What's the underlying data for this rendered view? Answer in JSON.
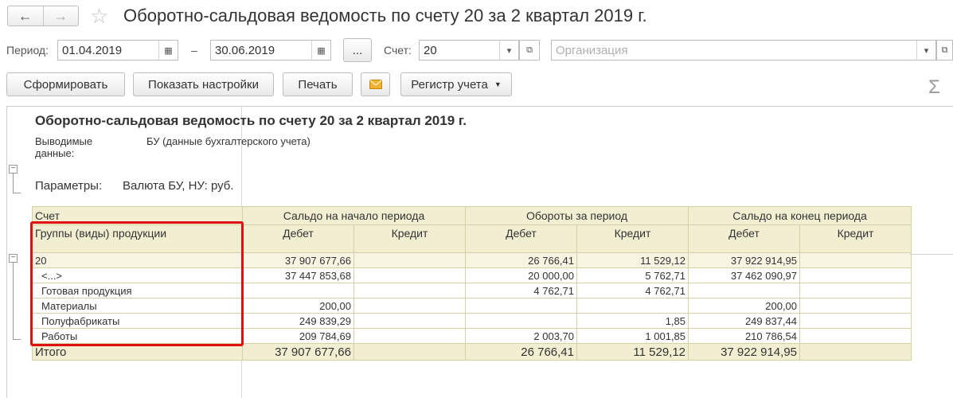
{
  "window": {
    "title": "Оборотно-сальдовая ведомость по счету 20 за 2 квартал 2019 г.",
    "back_icon": "←",
    "forward_icon": "→",
    "star_icon": "☆"
  },
  "form": {
    "period_label": "Период:",
    "date_from": "01.04.2019",
    "date_separator": "–",
    "date_to": "30.06.2019",
    "ellipsis_label": "...",
    "account_label": "Счет:",
    "account_value": "20",
    "organization_placeholder": "Организация"
  },
  "toolbar": {
    "generate_label": "Сформировать",
    "settings_label": "Показать настройки",
    "print_label": "Печать",
    "register_label": "Регистр учета",
    "sigma": "Σ"
  },
  "report": {
    "title": "Оборотно-сальдовая ведомость по счету 20 за 2 квартал 2019 г.",
    "output_label_1": "Выводимые",
    "output_label_2": "данные:",
    "output_value": "БУ (данные бухгалтерского учета)",
    "params_label": "Параметры:",
    "params_value": "Валюта БУ, НУ: руб.",
    "headers": {
      "account": "Счет",
      "groups": "Группы (виды) продукции",
      "opening": "Сальдо на начало периода",
      "turnover": "Обороты за период",
      "closing": "Сальдо на конец периода",
      "debit": "Дебет",
      "credit": "Кредит"
    },
    "rows": [
      {
        "name": "20",
        "ob_d": "37 907 677,66",
        "ob_c": "",
        "t_d": "26 766,41",
        "t_c": "11 529,12",
        "cb_d": "37 922 914,95",
        "cb_c": ""
      },
      {
        "name": "<...>",
        "ob_d": "37 447 853,68",
        "ob_c": "",
        "t_d": "20 000,00",
        "t_c": "5 762,71",
        "cb_d": "37 462 090,97",
        "cb_c": ""
      },
      {
        "name": "Готовая продукция",
        "ob_d": "",
        "ob_c": "",
        "t_d": "4 762,71",
        "t_c": "4 762,71",
        "cb_d": "",
        "cb_c": ""
      },
      {
        "name": "Материалы",
        "ob_d": "200,00",
        "ob_c": "",
        "t_d": "",
        "t_c": "",
        "cb_d": "200,00",
        "cb_c": ""
      },
      {
        "name": "Полуфабрикаты",
        "ob_d": "249 839,29",
        "ob_c": "",
        "t_d": "",
        "t_c": "1,85",
        "cb_d": "249 837,44",
        "cb_c": ""
      },
      {
        "name": "Работы",
        "ob_d": "209 784,69",
        "ob_c": "",
        "t_d": "2 003,70",
        "t_c": "1 001,85",
        "cb_d": "210 786,54",
        "cb_c": ""
      }
    ],
    "total": {
      "name": "Итого",
      "ob_d": "37 907 677,66",
      "ob_c": "",
      "t_d": "26 766,41",
      "t_c": "11 529,12",
      "cb_d": "37 922 914,95",
      "cb_c": ""
    }
  },
  "colors": {
    "header_bg": "#f2eed2",
    "highlight_border": "#e01010"
  }
}
